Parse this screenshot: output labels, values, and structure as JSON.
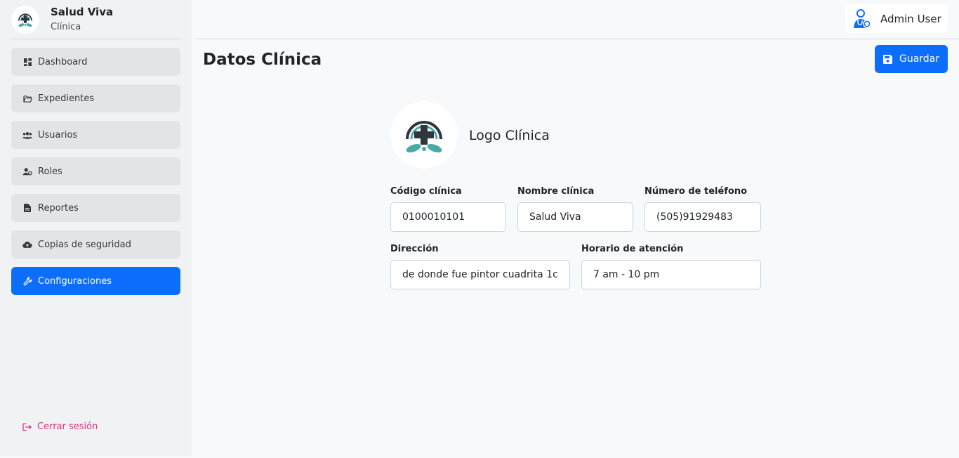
{
  "brand": {
    "name": "Salud Viva",
    "subtitle": "Clínica"
  },
  "sidebar": {
    "items": [
      {
        "label": "Dashboard",
        "icon": "dashboard-icon"
      },
      {
        "label": "Expedientes",
        "icon": "folder-open-icon"
      },
      {
        "label": "Usuarios",
        "icon": "users-icon"
      },
      {
        "label": "Roles",
        "icon": "user-gear-icon"
      },
      {
        "label": "Reportes",
        "icon": "file-icon"
      },
      {
        "label": "Copias de seguridad",
        "icon": "cloud-upload-icon"
      },
      {
        "label": "Configuraciones",
        "icon": "wrench-icon",
        "active": true
      }
    ],
    "logout_label": "Cerrar sesión"
  },
  "header": {
    "user_name": "Admin User"
  },
  "main": {
    "title": "Datos Clínica",
    "save_label": "Guardar",
    "logo_label": "Logo Clínica",
    "fields": {
      "codigo": {
        "label": "Código clínica",
        "value": "0100010101"
      },
      "nombre": {
        "label": "Nombre clínica",
        "value": "Salud Viva"
      },
      "telefono": {
        "label": "Número de teléfono",
        "value": "(505)91929483"
      },
      "direccion": {
        "label": "Dirección",
        "value": "de donde fue pintor cuadrita 1c"
      },
      "horario": {
        "label": "Horario de atención",
        "value": "7 am - 10 pm"
      }
    }
  },
  "colors": {
    "accent": "#0d6efd",
    "logout": "#d63384",
    "logo_teal": "#4aa9a4",
    "logo_dark": "#2f3640"
  }
}
